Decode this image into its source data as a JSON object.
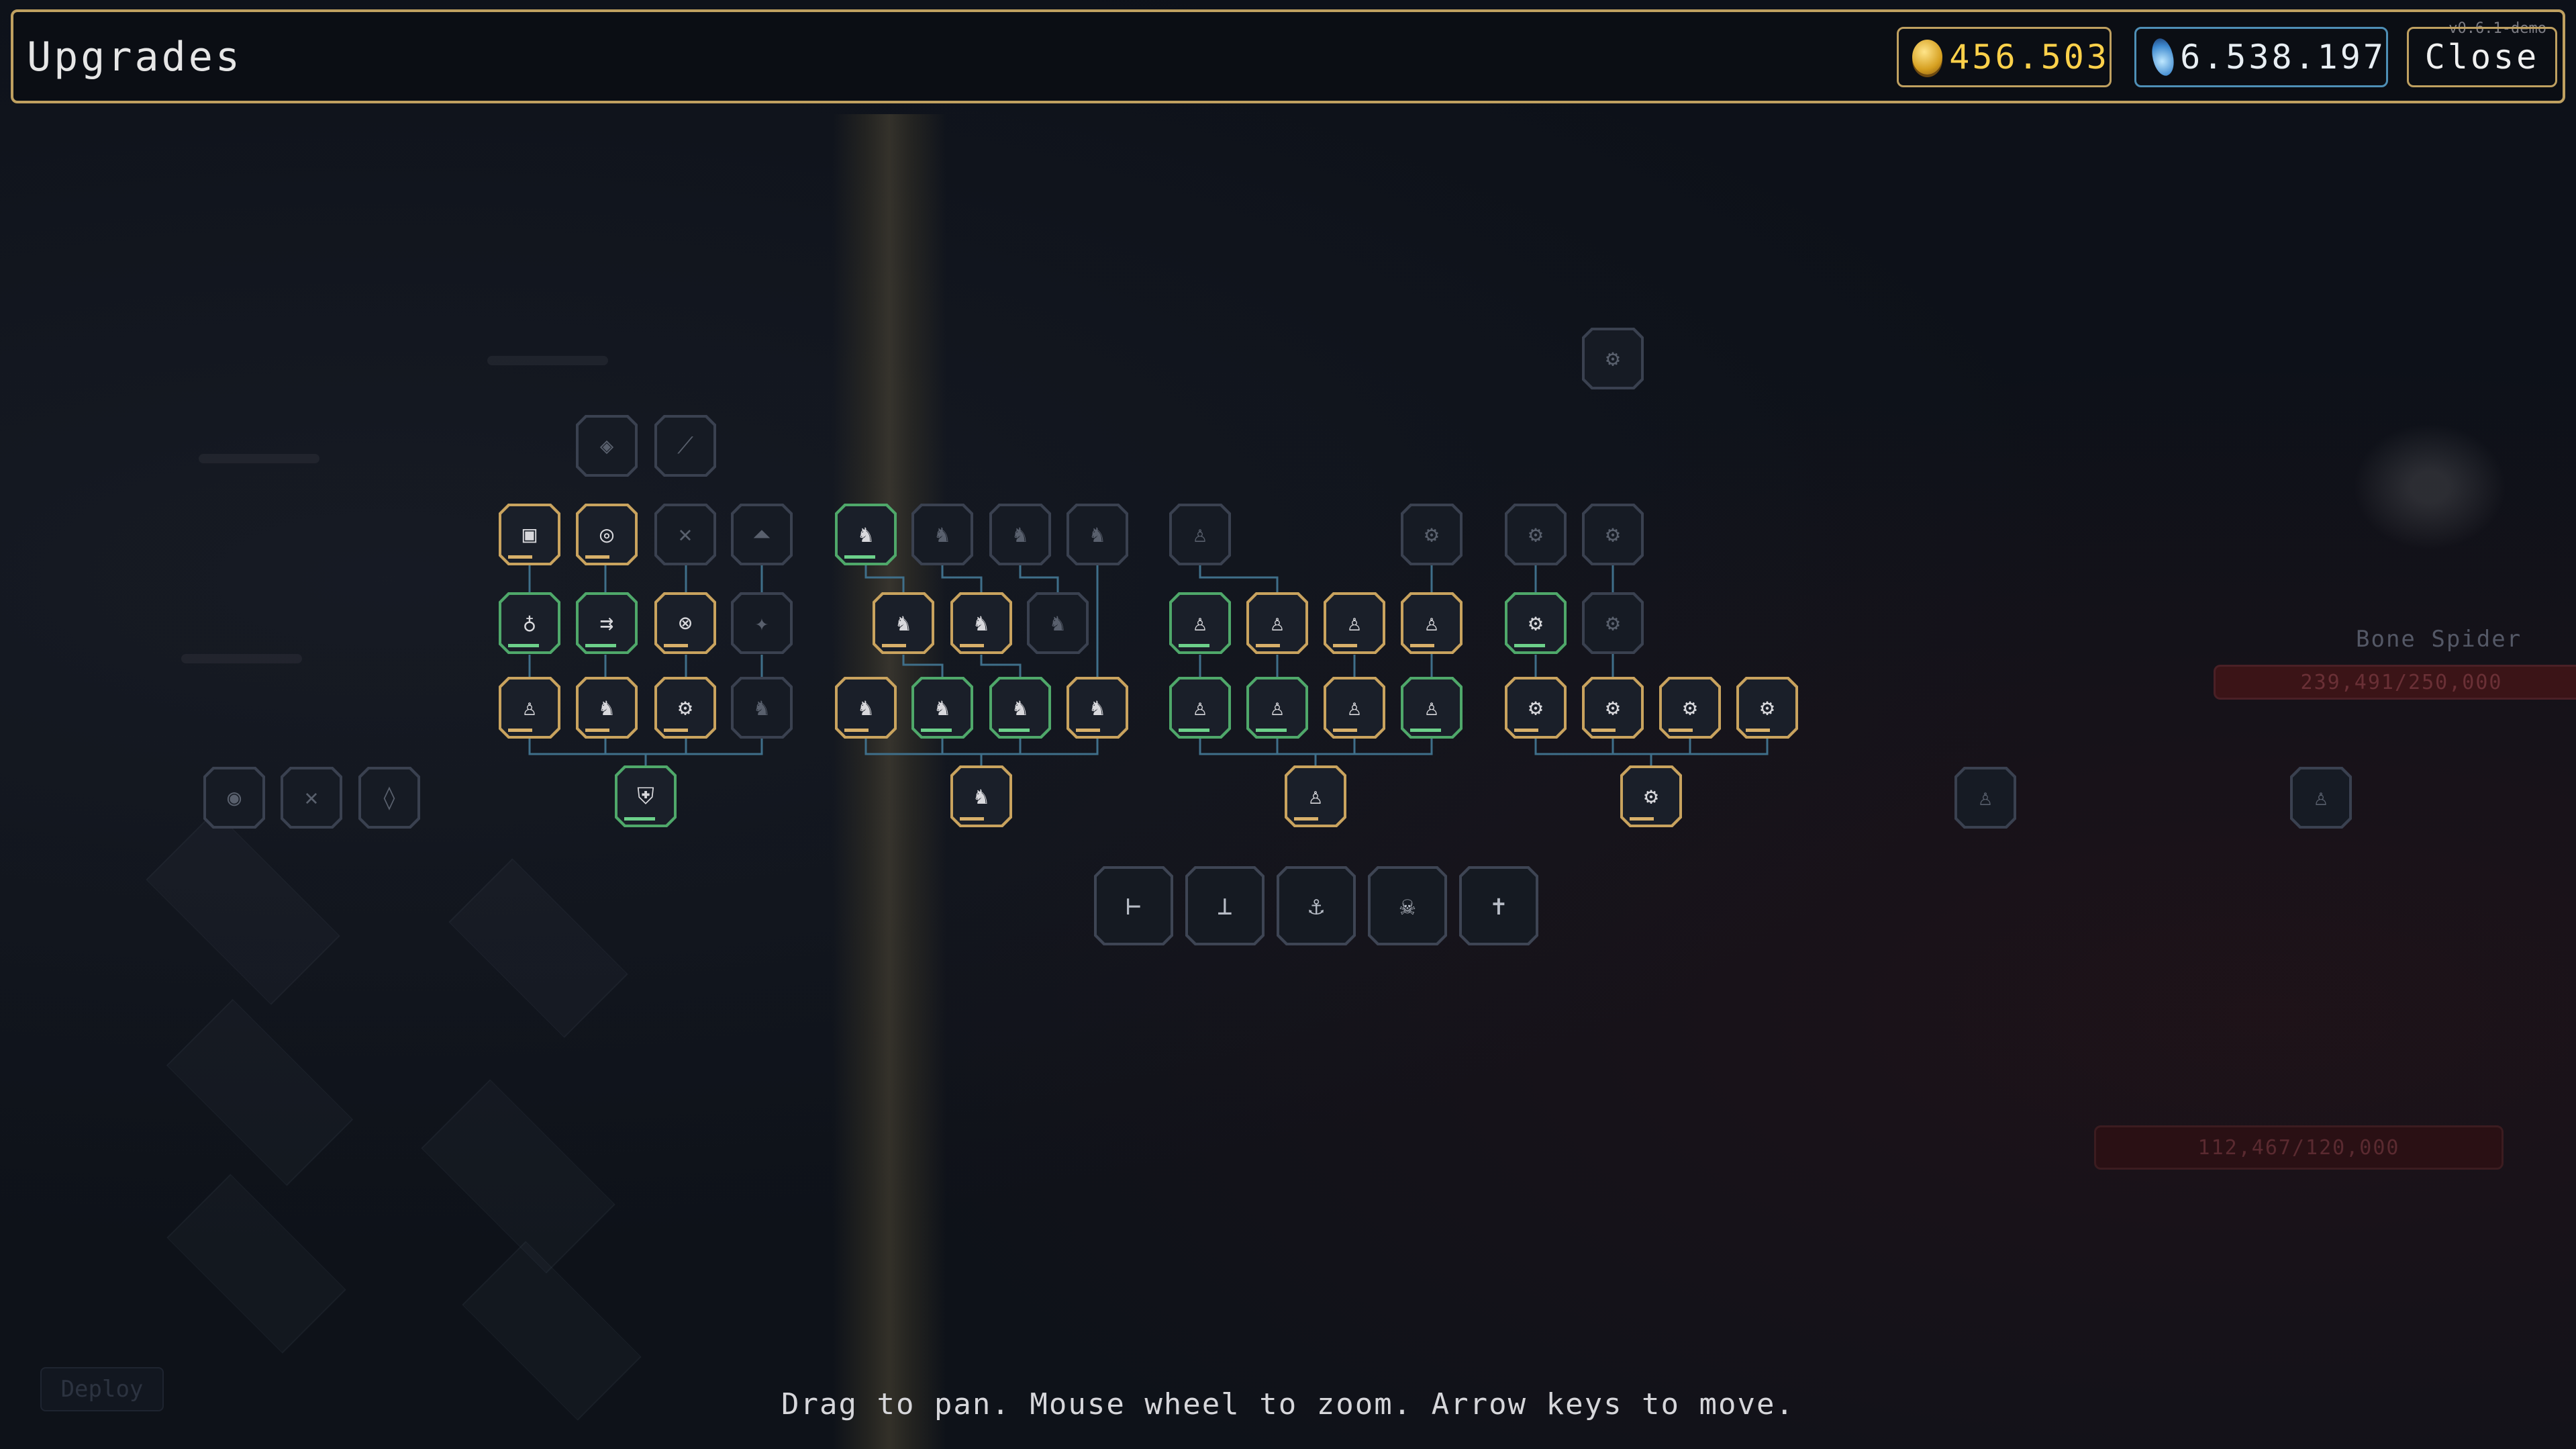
{
  "header": {
    "title": "Upgrades",
    "gold_amount": "456.503",
    "soul_amount": "6.538.197",
    "close_label": "Close",
    "version": "v0.6.1-demo"
  },
  "colors": {
    "frame_gold": "#bfa060",
    "node_gold": "#c9a35e",
    "node_green": "#4fa86a",
    "node_locked": "#3a4150",
    "soul_blue": "#4e8fb6",
    "coin_yellow": "#ffd14a"
  },
  "background_ui": {
    "enemy_name": "Bone Spider",
    "enemy_hp": "239,491/250,000",
    "base_hp": "112,467/120,000",
    "deploy_label": "Deploy"
  },
  "tree": {
    "nodes": [
      {
        "id": "n1",
        "state": "dim",
        "icon": "diamond-icon",
        "glyph": "◈"
      },
      {
        "id": "n2",
        "state": "dim",
        "icon": "feather-icon",
        "glyph": "⟋"
      },
      {
        "id": "n3",
        "state": "gold",
        "icon": "square-icon",
        "glyph": "▣"
      },
      {
        "id": "n4",
        "state": "gold",
        "icon": "ring-icon",
        "glyph": "◎"
      },
      {
        "id": "n5",
        "state": "dim",
        "icon": "cross-icon",
        "glyph": "✕"
      },
      {
        "id": "n6",
        "state": "dim",
        "icon": "mound-icon",
        "glyph": "⏶"
      },
      {
        "id": "n7",
        "state": "green",
        "icon": "lightbulb-icon",
        "glyph": "♁"
      },
      {
        "id": "n8",
        "state": "green",
        "icon": "arrows-icon",
        "glyph": "⇉"
      },
      {
        "id": "n9",
        "state": "gold",
        "icon": "crossed-swords-icon",
        "glyph": "⊗"
      },
      {
        "id": "n10",
        "state": "dim",
        "icon": "star-icon",
        "glyph": "✦"
      },
      {
        "id": "n11",
        "state": "gold",
        "icon": "soldier-icon",
        "glyph": "♙"
      },
      {
        "id": "n12",
        "state": "gold",
        "icon": "cavalry-icon",
        "glyph": "♞"
      },
      {
        "id": "n13",
        "state": "gold",
        "icon": "cannon-icon",
        "glyph": "⚙"
      },
      {
        "id": "n14",
        "state": "dim",
        "icon": "cavalry-icon",
        "glyph": "♞"
      },
      {
        "id": "n15",
        "state": "green",
        "icon": "shield-icon",
        "glyph": "⛨"
      },
      {
        "id": "n16",
        "state": "green",
        "icon": "cavalry-icon",
        "glyph": "♞"
      },
      {
        "id": "n17",
        "state": "dim",
        "icon": "cavalry-icon",
        "glyph": "♞"
      },
      {
        "id": "n18",
        "state": "dim",
        "icon": "cavalry-icon",
        "glyph": "♞"
      },
      {
        "id": "n19",
        "state": "dim",
        "icon": "cavalry-icon",
        "glyph": "♞"
      },
      {
        "id": "n20",
        "state": "gold",
        "icon": "cavalry-icon",
        "glyph": "♞"
      },
      {
        "id": "n21",
        "state": "gold",
        "icon": "cavalry-icon",
        "glyph": "♞"
      },
      {
        "id": "n22",
        "state": "dim",
        "icon": "cavalry-icon",
        "glyph": "♞"
      },
      {
        "id": "n23",
        "state": "gold",
        "icon": "cavalry-icon",
        "glyph": "♞"
      },
      {
        "id": "n24",
        "state": "green",
        "icon": "cavalry-icon",
        "glyph": "♞"
      },
      {
        "id": "n25",
        "state": "green",
        "icon": "cavalry-icon",
        "glyph": "♞"
      },
      {
        "id": "n26",
        "state": "gold",
        "icon": "cavalry-icon",
        "glyph": "♞"
      },
      {
        "id": "n27",
        "state": "gold",
        "icon": "cavalry-icon",
        "glyph": "♞"
      },
      {
        "id": "n28",
        "state": "dim",
        "icon": "soldier-icon",
        "glyph": "♙"
      },
      {
        "id": "n29",
        "state": "green",
        "icon": "soldier-icon",
        "glyph": "♙"
      },
      {
        "id": "n30",
        "state": "gold",
        "icon": "soldier-icon",
        "glyph": "♙"
      },
      {
        "id": "n31",
        "state": "gold",
        "icon": "soldier-icon",
        "glyph": "♙"
      },
      {
        "id": "n32",
        "state": "gold",
        "icon": "soldier-icon",
        "glyph": "♙"
      },
      {
        "id": "n33",
        "state": "green",
        "icon": "soldier-icon",
        "glyph": "♙"
      },
      {
        "id": "n34",
        "state": "green",
        "icon": "soldier-icon",
        "glyph": "♙"
      },
      {
        "id": "n35",
        "state": "gold",
        "icon": "soldier-icon",
        "glyph": "♙"
      },
      {
        "id": "n36",
        "state": "green",
        "icon": "soldier-icon",
        "glyph": "♙"
      },
      {
        "id": "n37",
        "state": "gold",
        "icon": "soldier-icon",
        "glyph": "♙"
      },
      {
        "id": "n38",
        "state": "dim",
        "icon": "cannon-icon",
        "glyph": "⚙"
      },
      {
        "id": "n39",
        "state": "dim",
        "icon": "cannon-icon",
        "glyph": "⚙"
      },
      {
        "id": "n40",
        "state": "dim",
        "icon": "cannon-icon",
        "glyph": "⚙"
      },
      {
        "id": "n41",
        "state": "green",
        "icon": "cannon-icon",
        "glyph": "⚙"
      },
      {
        "id": "n42",
        "state": "dim",
        "icon": "cannon-icon",
        "glyph": "⚙"
      },
      {
        "id": "n43",
        "state": "gold",
        "icon": "cannon-icon",
        "glyph": "⚙"
      },
      {
        "id": "n44",
        "state": "gold",
        "icon": "cannon-icon",
        "glyph": "⚙"
      },
      {
        "id": "n45",
        "state": "gold",
        "icon": "cannon-icon",
        "glyph": "⚙"
      },
      {
        "id": "n46",
        "state": "gold",
        "icon": "cannon-icon",
        "glyph": "⚙"
      },
      {
        "id": "n47",
        "state": "gold",
        "icon": "cannon-icon",
        "glyph": "⚙"
      },
      {
        "id": "n48",
        "state": "dim",
        "icon": "cannon-icon",
        "glyph": "⚙"
      },
      {
        "id": "n49",
        "state": "dim",
        "icon": "ring-icon",
        "glyph": "◉"
      },
      {
        "id": "n50",
        "state": "dim",
        "icon": "cross-icon",
        "glyph": "✕"
      },
      {
        "id": "n51",
        "state": "dim",
        "icon": "gem-icon",
        "glyph": "◊"
      },
      {
        "id": "n52",
        "state": "dim",
        "icon": "soldier-icon",
        "glyph": "♙"
      },
      {
        "id": "n53",
        "state": "dim",
        "icon": "soldier-icon",
        "glyph": "♙"
      }
    ],
    "big_nodes": [
      {
        "id": "b1",
        "icon": "beam-icon",
        "glyph": "⊢"
      },
      {
        "id": "b2",
        "icon": "sword-icon",
        "glyph": "⊥"
      },
      {
        "id": "b3",
        "icon": "anchor-icon",
        "glyph": "⚓"
      },
      {
        "id": "b4",
        "icon": "skull-icon",
        "glyph": "☠"
      },
      {
        "id": "b5",
        "icon": "cross-hilt-icon",
        "glyph": "✝"
      }
    ]
  },
  "footer": {
    "hint": "Drag to pan. Mouse wheel to zoom. Arrow keys to move."
  }
}
